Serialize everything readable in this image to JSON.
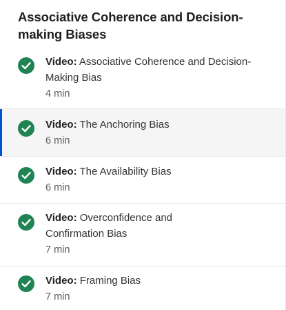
{
  "module": {
    "title": "Associative Coherence and Decision-making Biases"
  },
  "colors": {
    "check_green": "#1f8354",
    "active_accent": "#0056d2",
    "active_background": "#f5f5f5"
  },
  "lessons": [
    {
      "type": "Video:",
      "title": "Associative Coherence and Decision-Making Bias",
      "duration": "4 min",
      "status_icon": "check-circle-icon",
      "active": false
    },
    {
      "type": "Video:",
      "title": "The Anchoring Bias",
      "duration": "6 min",
      "status_icon": "check-circle-icon",
      "active": true
    },
    {
      "type": "Video:",
      "title": "The Availability Bias",
      "duration": "6 min",
      "status_icon": "check-circle-icon",
      "active": false
    },
    {
      "type": "Video:",
      "title": "Overconfidence and Confirmation Bias",
      "duration": "7 min",
      "status_icon": "check-circle-icon",
      "active": false
    },
    {
      "type": "Video:",
      "title": "Framing Bias",
      "duration": "7 min",
      "status_icon": "check-circle-icon",
      "active": false
    }
  ]
}
